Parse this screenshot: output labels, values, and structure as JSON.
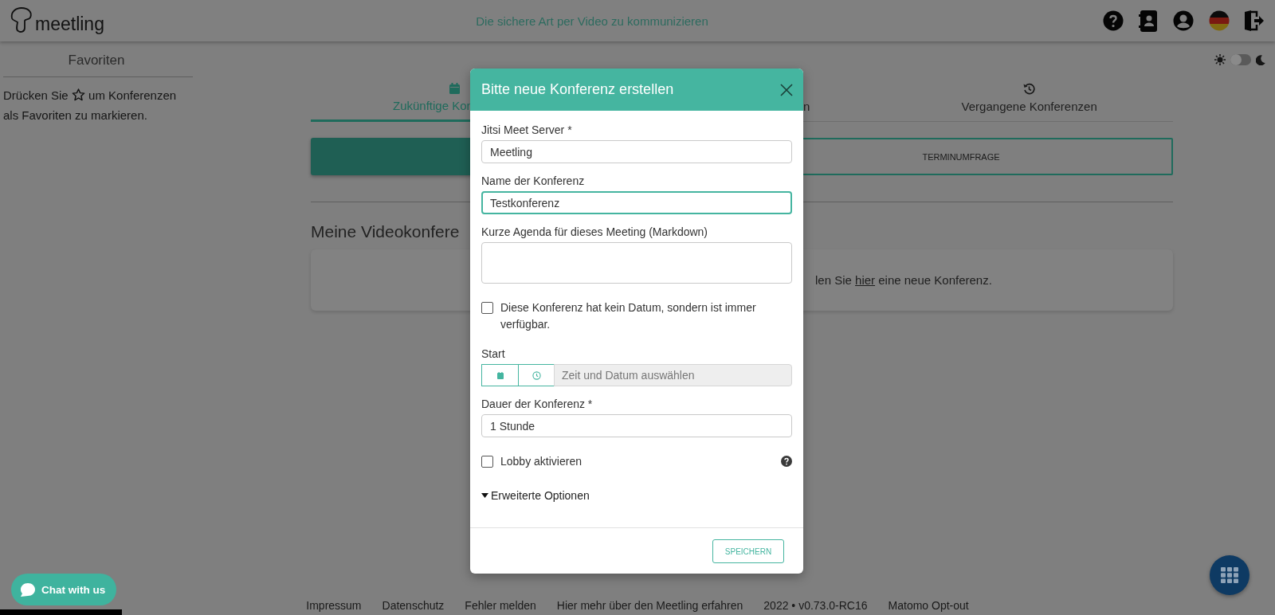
{
  "header": {
    "logo_text": "meetling",
    "tagline": "Die sichere Art per Video zu kommunizieren"
  },
  "sidebar": {
    "title": "Favoriten",
    "hint_before": "Drücken Sie",
    "hint_after": "um Konferenzen als Favoriten zu markieren."
  },
  "theme_toggle": {
    "on": false
  },
  "tabs": [
    {
      "label": "Zukünftige Kon",
      "selected": true
    },
    {
      "label": "n",
      "selected": false
    },
    {
      "label": "Vergangene Konferenzen",
      "selected": false
    }
  ],
  "poll_button": "TERMINUMFRAGE",
  "section_heading": "Meine Videokonfere",
  "empty_state": {
    "before": "len Sie ",
    "link": "hier",
    "after": " eine neue Konferenz."
  },
  "dialog": {
    "title": "Bitte neue Konferenz erstellen",
    "fields": [
      {
        "kind": "input",
        "label": "Jitsi Meet Server *",
        "value": "Meetling",
        "focused": false
      },
      {
        "kind": "input",
        "label": "Name der Konferenz",
        "value": "Testkonferenz",
        "focused": true
      },
      {
        "kind": "textarea",
        "label": "Kurze Agenda für dieses Meeting (Markdown)"
      },
      {
        "kind": "checkbox",
        "label": "Diese Konferenz hat kein Datum, sondern ist immer verfügbar.",
        "checked": false,
        "help": false
      },
      {
        "kind": "datetime",
        "label": "Start",
        "placeholder": "Zeit und Datum auswählen"
      },
      {
        "kind": "input",
        "label": "Dauer der Konferenz *",
        "value": "1 Stunde",
        "focused": false
      },
      {
        "kind": "checkbox",
        "label": "Lobby aktivieren",
        "checked": false,
        "help": true
      },
      {
        "kind": "expander",
        "label": "Erweiterte Optionen"
      }
    ],
    "save_button": "SPEICHERN"
  },
  "footer": [
    "Impressum",
    "Datenschutz",
    "Fehler melden",
    "Hier mehr über den Meetling erfahren",
    "2022 • v0.73.0-RC16",
    "Matomo Opt-out"
  ],
  "chat_button": "Chat with us"
}
